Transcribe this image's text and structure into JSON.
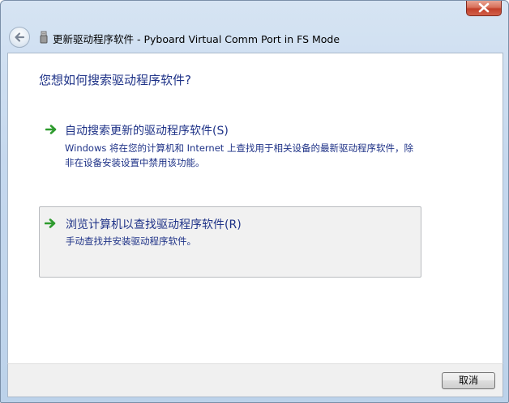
{
  "window": {
    "title": "更新驱动程序软件 - Pyboard Virtual Comm Port in FS Mode"
  },
  "titlebar": {
    "close_icon": "close-icon",
    "back_icon": "back-arrow-icon",
    "device_icon": "usb-device-icon"
  },
  "content": {
    "prompt": "您想如何搜索驱动程序软件?",
    "options": [
      {
        "title": "自动搜索更新的驱动程序软件(S)",
        "description": "Windows 将在您的计算机和 Internet 上查找用于相关设备的最新驱动程序软件，除非在设备安装设置中禁用该功能。",
        "icon": "green-arrow-icon"
      },
      {
        "title": "浏览计算机以查找驱动程序软件(R)",
        "description": "手动查找并安装驱动程序软件。",
        "icon": "green-arrow-icon",
        "highlighted": true
      }
    ]
  },
  "footer": {
    "cancel_label": "取消"
  },
  "colors": {
    "link_text": "#1e3287",
    "arrow_green": "#2e9b2e",
    "close_red": "#c2402a",
    "chrome_blue": "#c5d8ee"
  }
}
